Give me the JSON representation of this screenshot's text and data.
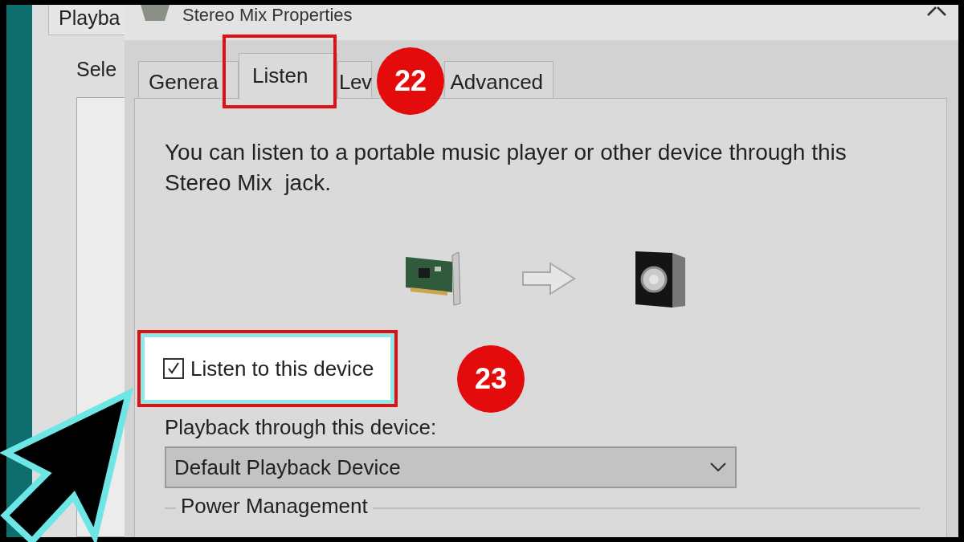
{
  "background_window": {
    "tab": "Playba",
    "label": "Sele"
  },
  "window": {
    "title": "Stereo Mix Properties"
  },
  "tabs": [
    {
      "label": "Genera",
      "selected": false
    },
    {
      "label": "Listen",
      "selected": true
    },
    {
      "label": "Lev",
      "selected": false
    },
    {
      "label": "Advanced",
      "selected": false
    }
  ],
  "description": "You can listen to a portable music player or other device through this  Stereo Mix  jack.",
  "listen_checkbox": {
    "label": "Listen to this device",
    "checked": true
  },
  "playback_label": "Playback through this device:",
  "playback_dropdown": {
    "value": "Default Playback Device"
  },
  "power_management": {
    "title": "Power Management"
  },
  "annotations": [
    {
      "number": "22"
    },
    {
      "number": "23"
    }
  ]
}
